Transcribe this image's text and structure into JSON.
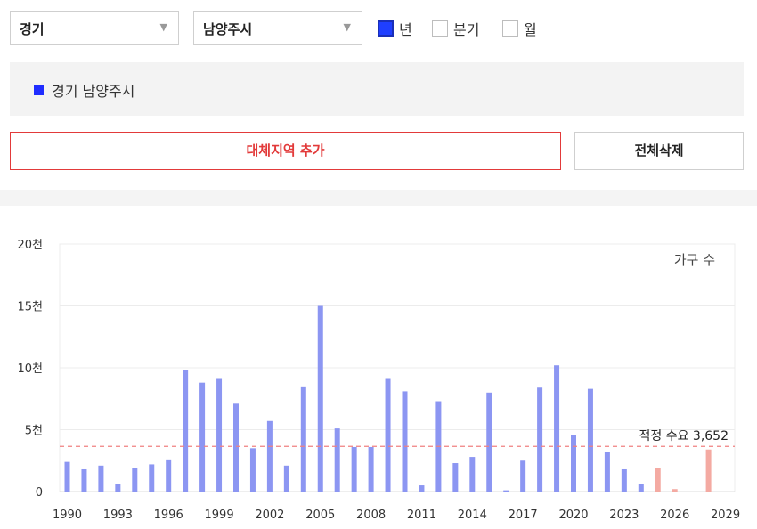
{
  "filters": {
    "province": "경기",
    "city": "남양주시",
    "arrow": "▼",
    "periods": [
      {
        "label": "년",
        "checked": true
      },
      {
        "label": "분기",
        "checked": false
      },
      {
        "label": "월",
        "checked": false
      }
    ]
  },
  "legend": {
    "label": "경기 남양주시",
    "color": "#1f2dff"
  },
  "buttons": {
    "add_region": "대체지역 추가",
    "delete_all": "전체삭제"
  },
  "chart_data": {
    "type": "bar",
    "unit_label": "가구 수",
    "ylim": [
      0,
      20000
    ],
    "y_ticks": [
      {
        "value": 0,
        "label": "0"
      },
      {
        "value": 5000,
        "label": "5천"
      },
      {
        "value": 10000,
        "label": "10천"
      },
      {
        "value": 15000,
        "label": "15천"
      },
      {
        "value": 20000,
        "label": "20천"
      }
    ],
    "x_tick_labels": [
      "1990",
      "1993",
      "1996",
      "1999",
      "2002",
      "2005",
      "2008",
      "2011",
      "2014",
      "2017",
      "2020",
      "2023",
      "2026",
      "2029"
    ],
    "x_range": [
      1990,
      2029
    ],
    "grid": true,
    "series": [
      {
        "color": "#8c96f2",
        "points": [
          [
            1990,
            2400
          ],
          [
            1991,
            1800
          ],
          [
            1992,
            2100
          ],
          [
            1993,
            600
          ],
          [
            1994,
            1900
          ],
          [
            1995,
            2200
          ],
          [
            1996,
            2600
          ],
          [
            1997,
            9800
          ],
          [
            1998,
            8800
          ],
          [
            1999,
            9100
          ],
          [
            2000,
            7100
          ],
          [
            2001,
            3500
          ],
          [
            2002,
            5700
          ],
          [
            2003,
            2100
          ],
          [
            2004,
            8500
          ],
          [
            2005,
            15000
          ],
          [
            2006,
            5100
          ],
          [
            2007,
            3600
          ],
          [
            2008,
            3600
          ],
          [
            2009,
            9100
          ],
          [
            2010,
            8100
          ],
          [
            2011,
            500
          ],
          [
            2012,
            7300
          ],
          [
            2013,
            2300
          ],
          [
            2014,
            2800
          ],
          [
            2015,
            8000
          ],
          [
            2016,
            100
          ],
          [
            2017,
            2500
          ],
          [
            2018,
            8400
          ],
          [
            2019,
            10200
          ],
          [
            2020,
            4600
          ],
          [
            2021,
            8300
          ],
          [
            2022,
            3200
          ],
          [
            2023,
            1800
          ],
          [
            2024,
            600
          ]
        ]
      },
      {
        "color": "#f4aaa2",
        "points": [
          [
            2025,
            1900
          ],
          [
            2026,
            200
          ],
          [
            2028,
            3400
          ]
        ]
      }
    ],
    "reference_line": {
      "value": 3652,
      "label": "적정 수요 3,652",
      "color": "#f08080"
    }
  }
}
